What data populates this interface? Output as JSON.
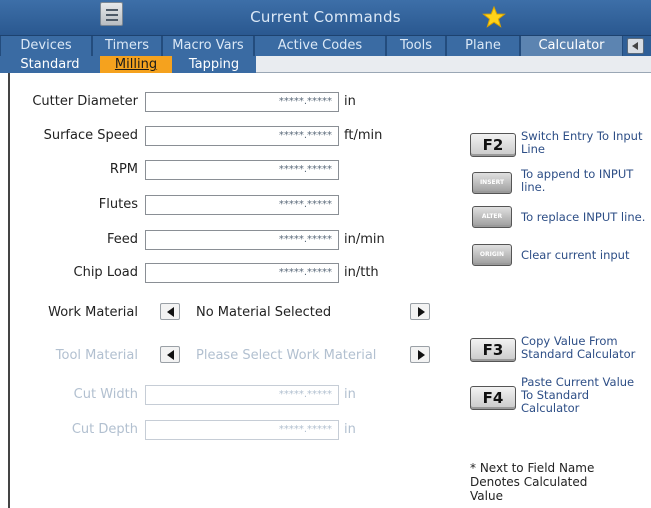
{
  "window": {
    "title": "Current Commands"
  },
  "tabs": [
    "Devices",
    "Timers",
    "Macro Vars",
    "Active Codes",
    "Tools",
    "Plane",
    "Calculator"
  ],
  "active_tab": "Calculator",
  "subtabs": [
    "Standard",
    "Milling",
    "Tapping"
  ],
  "active_subtab": "Milling",
  "fields": [
    {
      "label": "Cutter Diameter",
      "value": "*****.*****",
      "unit": "in"
    },
    {
      "label": "Surface Speed",
      "value": "*****.*****",
      "unit": "ft/min"
    },
    {
      "label": "RPM",
      "value": "*****.*****",
      "unit": ""
    },
    {
      "label": "Flutes",
      "value": "*****.*****",
      "unit": ""
    },
    {
      "label": "Feed",
      "value": "*****.*****",
      "unit": "in/min"
    },
    {
      "label": "Chip Load",
      "value": "*****.*****",
      "unit": "in/tth"
    }
  ],
  "work_material": {
    "label": "Work Material",
    "value": "No Material Selected"
  },
  "tool_material": {
    "label": "Tool Material",
    "value": "Please Select Work Material"
  },
  "cut_width": {
    "label": "Cut Width",
    "value": "*****.*****",
    "unit": "in"
  },
  "cut_depth": {
    "label": "Cut Depth",
    "value": "*****.*****",
    "unit": "in"
  },
  "help": [
    {
      "key": "F2",
      "text": "Switch Entry To Input Line"
    },
    {
      "key": "INSERT",
      "text": "To append to INPUT line."
    },
    {
      "key": "ALTER",
      "text": "To replace INPUT line."
    },
    {
      "key": "ORIGIN",
      "text": "Clear current input"
    },
    {
      "key": "F3",
      "text": "Copy Value From Standard Calculator"
    },
    {
      "key": "F4",
      "text": "Paste Current Value To Standard Calculator"
    }
  ],
  "footnote": "* Next to Field Name Denotes Calculated Value",
  "colors": {
    "titlebar": "#2f5f97",
    "active_subtab": "#f5a21e",
    "help_text": "#2d4e86",
    "disabled_text": "#b2c0d0"
  }
}
